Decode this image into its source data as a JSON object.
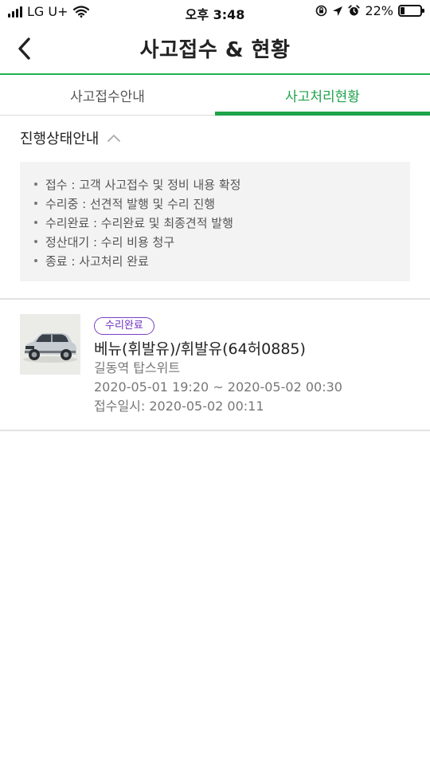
{
  "status_bar": {
    "carrier": "LG U+",
    "time": "오후 3:48",
    "battery": "22%",
    "battery_level": 0.22
  },
  "header": {
    "title": "사고접수 & 현황"
  },
  "tabs": [
    {
      "label": "사고접수안내",
      "active": false
    },
    {
      "label": "사고처리현황",
      "active": true
    }
  ],
  "guide": {
    "title": "진행상태안내",
    "items": [
      "접수 : 고객 사고접수 및 정비 내용 확정",
      "수리중 : 선견적 발행 및 수리 진행",
      "수리완료 : 수리완료 및 최종견적 발행",
      "정산대기 : 수리 비용 청구",
      "종료 : 사고처리 완료"
    ]
  },
  "accidents": [
    {
      "status": "수리완료",
      "car": "베뉴(휘발유)/휘발유(64허0885)",
      "location": "길동역 탑스위트",
      "period": "2020-05-01 19:20 ~ 2020-05-02 00:30",
      "received": "접수일시: 2020-05-02 00:11"
    }
  ],
  "colors": {
    "accent": "#1ea34a",
    "badge": "#7a3fc6"
  }
}
